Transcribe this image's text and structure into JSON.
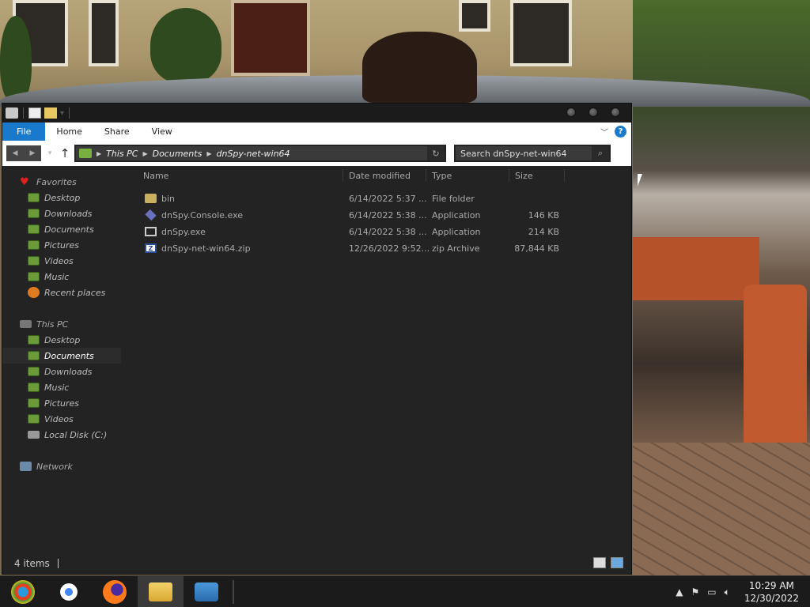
{
  "window": {
    "ribbon_tabs": [
      "File",
      "Home",
      "Share",
      "View"
    ],
    "help_label": "?",
    "breadcrumb": [
      "This PC",
      "Documents",
      "dnSpy-net-win64"
    ],
    "search_placeholder": "Search dnSpy-net-win64"
  },
  "navpane": {
    "favorites_label": "Favorites",
    "favorites": [
      "Desktop",
      "Downloads",
      "Documents",
      "Pictures",
      "Videos",
      "Music",
      "Recent places"
    ],
    "thispc_label": "This PC",
    "thispc": [
      "Desktop",
      "Documents",
      "Downloads",
      "Music",
      "Pictures",
      "Videos",
      "Local Disk (C:)"
    ],
    "selected": "Documents",
    "network_label": "Network"
  },
  "columns": {
    "name": "Name",
    "date": "Date modified",
    "type": "Type",
    "size": "Size"
  },
  "files": [
    {
      "name": "bin",
      "date": "6/14/2022 5:37 ...",
      "type": "File folder",
      "size": "",
      "icon": "folder-icon"
    },
    {
      "name": "dnSpy.Console.exe",
      "date": "6/14/2022 5:38 ...",
      "type": "Application",
      "size": "146 KB",
      "icon": "console-app-icon"
    },
    {
      "name": "dnSpy.exe",
      "date": "6/14/2022 5:38 ...",
      "type": "Application",
      "size": "214 KB",
      "icon": "app-icon"
    },
    {
      "name": "dnSpy-net-win64.zip",
      "date": "12/26/2022 9:52...",
      "type": "zip Archive",
      "size": "87,844 KB",
      "icon": "zip-icon"
    }
  ],
  "status": {
    "count": "4 items"
  },
  "taskbar": {
    "apps": [
      "start-icon",
      "chrome-icon",
      "firefox-icon",
      "file-explorer-icon",
      "people-icon"
    ],
    "time": "10:29 AM",
    "date": "12/30/2022"
  },
  "colors": {
    "accent": "#1979ca",
    "window_bg": "#232323",
    "taskbar_bg": "#1b1b1b"
  }
}
